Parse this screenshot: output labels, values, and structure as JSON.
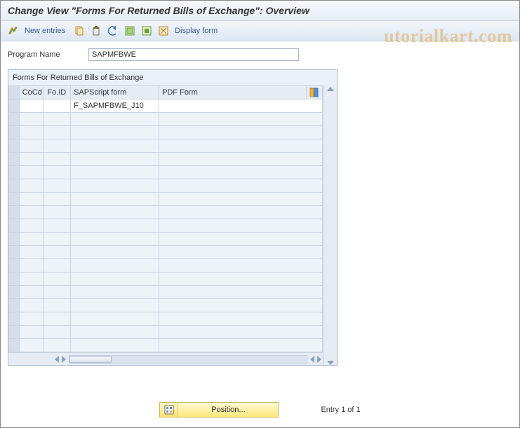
{
  "title": "Change View \"Forms For Returned Bills of Exchange\": Overview",
  "toolbar": {
    "new_entries": "New entries",
    "display_form": "Display form"
  },
  "program_name": {
    "label": "Program Name",
    "value": "SAPMFBWE"
  },
  "table": {
    "title": "Forms For Returned Bills of Exchange",
    "columns": {
      "cocd": "CoCd",
      "foid": "Fo.ID",
      "sapscript": "SAPScript form",
      "pdf": "PDF Form"
    },
    "rows": [
      {
        "cocd": "",
        "foid": "",
        "sapscript": "F_SAPMFBWE_J10",
        "pdf": ""
      }
    ],
    "empty_row_count": 18
  },
  "footer": {
    "position_label": "Position...",
    "entry_text": "Entry 1 of 1"
  },
  "watermark": "utorialkart.com"
}
